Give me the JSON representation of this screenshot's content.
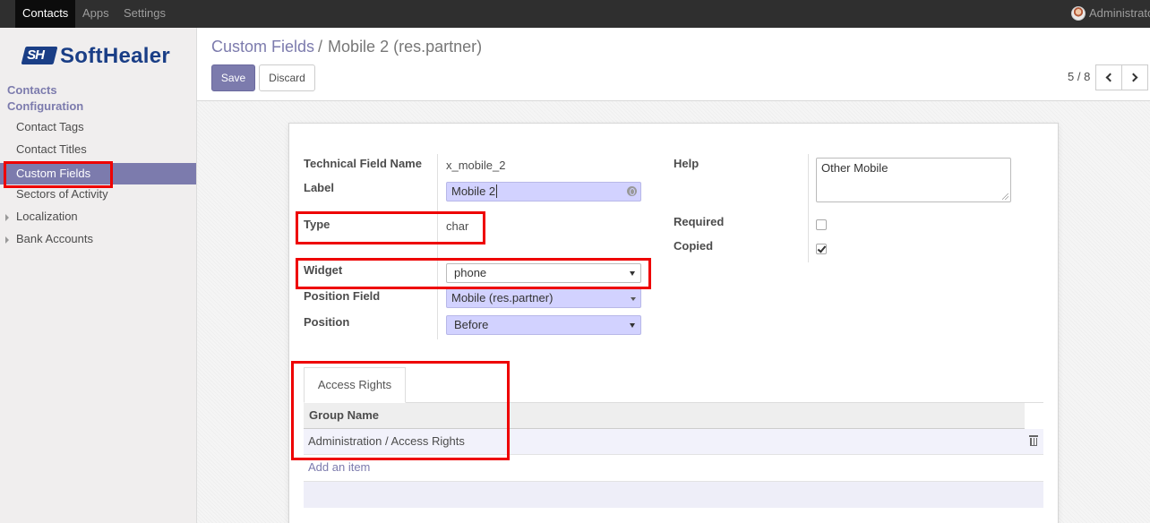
{
  "navbar": {
    "menus": [
      "Contacts",
      "Apps",
      "Settings"
    ],
    "active": "Contacts",
    "user": "Administrator"
  },
  "logo": {
    "text": "SoftHealer",
    "mark_text": "SH",
    "brand_color": "#1a3e86"
  },
  "sidebar": {
    "sections": [
      {
        "label": "Contacts"
      },
      {
        "label": "Configuration"
      }
    ],
    "items": [
      {
        "label": "Contact Tags",
        "expandable": false
      },
      {
        "label": "Contact Titles",
        "expandable": false
      },
      {
        "label": "Custom Fields",
        "expandable": false,
        "active": true
      },
      {
        "label": "Sectors of Activity",
        "expandable": false
      },
      {
        "label": "Localization",
        "expandable": true
      },
      {
        "label": "Bank Accounts",
        "expandable": true
      }
    ]
  },
  "breadcrumb": {
    "parent": "Custom Fields",
    "separator": "/",
    "current": "Mobile 2 (res.partner)"
  },
  "buttons": {
    "save": "Save",
    "discard": "Discard"
  },
  "pager": {
    "value": "5 / 8"
  },
  "form": {
    "technical_field_name": {
      "label": "Technical Field Name",
      "value": "x_mobile_2"
    },
    "label": {
      "label": "Label",
      "value": "Mobile 2"
    },
    "type": {
      "label": "Type",
      "value": "char"
    },
    "widget": {
      "label": "Widget",
      "value": "phone"
    },
    "position_field": {
      "label": "Position Field",
      "value": "Mobile (res.partner)"
    },
    "position": {
      "label": "Position",
      "value": "Before"
    },
    "help": {
      "label": "Help",
      "value": "Other Mobile"
    },
    "required": {
      "label": "Required",
      "checked": false
    },
    "copied": {
      "label": "Copied",
      "checked": true
    }
  },
  "tabs": [
    {
      "label": "Access Rights",
      "active": true
    }
  ],
  "access_table": {
    "header": "Group Name",
    "rows": [
      {
        "group": "Administration / Access Rights"
      }
    ],
    "add_item": "Add an item"
  },
  "colors": {
    "accent": "#7c7bad",
    "navbar": "#2f2f2f",
    "highlight": "#ee0000"
  }
}
